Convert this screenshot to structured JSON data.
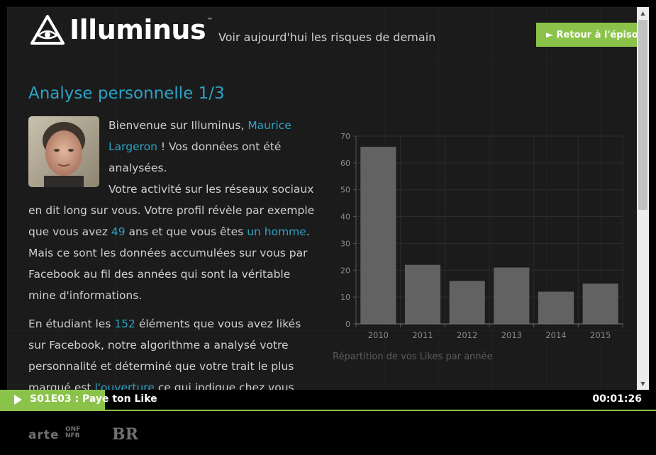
{
  "header": {
    "logo_text": "Illuminus",
    "logo_tm": "™",
    "tagline": "Voir aujourd'hui les risques de demain",
    "back_button": "► Retour à l'épisode"
  },
  "main": {
    "title": "Analyse personnelle 1/3",
    "p1": {
      "t1": "Bienvenue sur Illuminus, ",
      "name": "Maurice Largeron",
      "t2": " ! Vos données ont été analysées."
    },
    "p2": {
      "t1": "Votre activité sur les réseaux sociaux en dit long sur vous. Votre profil révèle par exemple que vous avez ",
      "age": "49",
      "t2": " ans et que vous êtes ",
      "gender": "un homme",
      "t3": ". Mais ce sont les données accumulées sur vous par Facebook au fil des années qui sont la véritable mine d'informations."
    },
    "p3": {
      "t1": "En étudiant les ",
      "count": "152",
      "t2": " éléments que vous avez likés sur Facebook, notre algorithme a analysé votre personnalité et déterminé que votre trait le plus marqué est ",
      "trait": "l'ouverture",
      "t3": " ce qui indique chez vous"
    }
  },
  "chart_data": {
    "type": "bar",
    "categories": [
      "2010",
      "2011",
      "2012",
      "2013",
      "2014",
      "2015"
    ],
    "values": [
      66,
      22,
      16,
      21,
      12,
      15
    ],
    "ylim": [
      0,
      70
    ],
    "yticks": [
      0,
      10,
      20,
      30,
      40,
      50,
      60,
      70
    ],
    "grid": true,
    "caption": "Répartition de vos Likes par année",
    "bar_color": "#626262"
  },
  "player": {
    "episode": "S01E03 : Paye ton Like",
    "time": "00:01:26"
  },
  "footer": {
    "brands": [
      "arte",
      "ONF NFB",
      "BR"
    ]
  },
  "colors": {
    "accent": "#8bc34a",
    "link": "#2aa3c6",
    "background": "#1b1b1b"
  }
}
